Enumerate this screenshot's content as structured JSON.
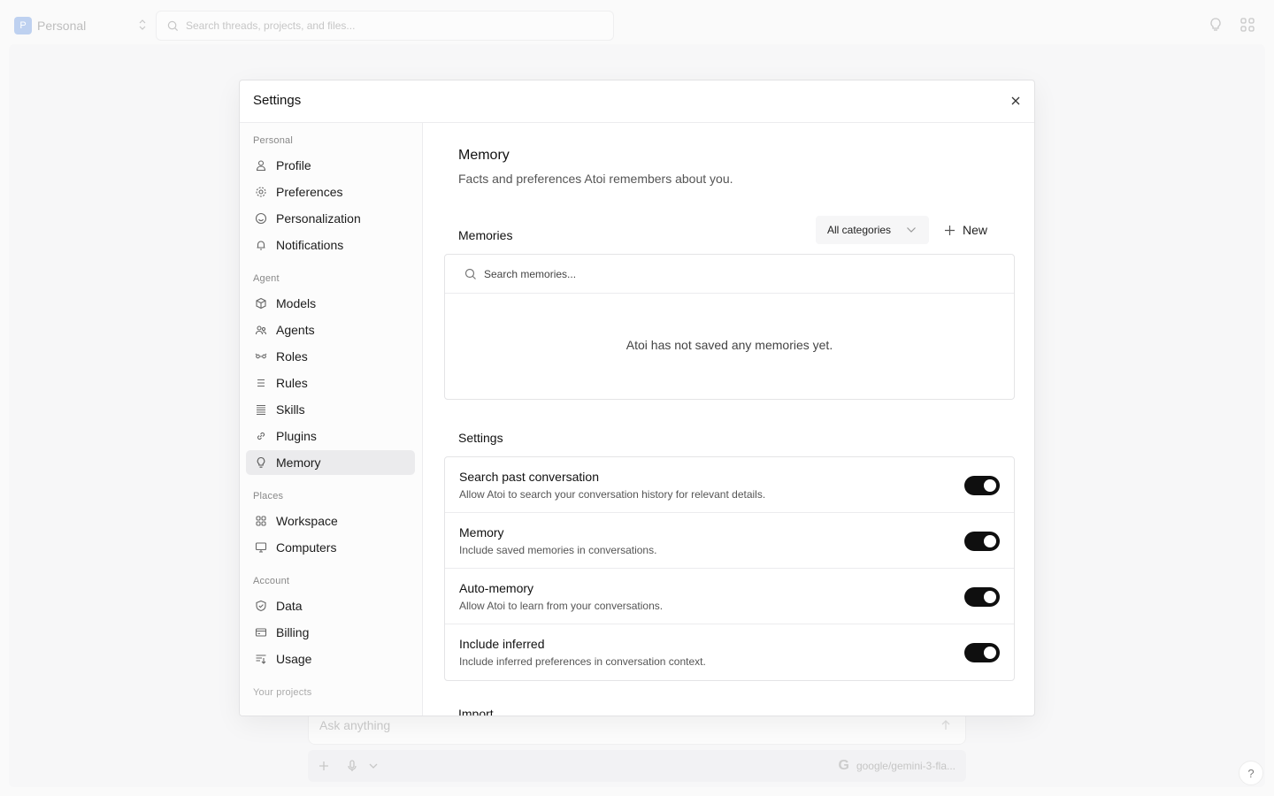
{
  "topbar": {
    "workspace_initial": "P",
    "workspace_name": "Personal",
    "search_placeholder": "Search threads, projects, and files...",
    "icons": [
      "lightbulb-icon",
      "apps-grid-icon"
    ]
  },
  "composer": {
    "placeholder": "Ask anything",
    "model": "google/gemini-3-fla...",
    "help_label": "?"
  },
  "modal": {
    "title": "Settings",
    "sidebar": {
      "groups": [
        {
          "label": "Personal",
          "items": [
            {
              "label": "Profile",
              "icon": "user-icon"
            },
            {
              "label": "Preferences",
              "icon": "gear-icon"
            },
            {
              "label": "Personalization",
              "icon": "smile-icon"
            },
            {
              "label": "Notifications",
              "icon": "bell-icon"
            }
          ]
        },
        {
          "label": "Agent",
          "items": [
            {
              "label": "Models",
              "icon": "cube-icon"
            },
            {
              "label": "Agents",
              "icon": "agents-icon"
            },
            {
              "label": "Roles",
              "icon": "roles-icon"
            },
            {
              "label": "Rules",
              "icon": "list-icon"
            },
            {
              "label": "Skills",
              "icon": "stack-icon"
            },
            {
              "label": "Plugins",
              "icon": "link-icon"
            },
            {
              "label": "Memory",
              "icon": "lightbulb-icon",
              "active": true
            }
          ]
        },
        {
          "label": "Places",
          "items": [
            {
              "label": "Workspace",
              "icon": "grid-icon"
            },
            {
              "label": "Computers",
              "icon": "monitor-icon"
            }
          ]
        },
        {
          "label": "Account",
          "items": [
            {
              "label": "Data",
              "icon": "shield-icon"
            },
            {
              "label": "Billing",
              "icon": "card-icon"
            },
            {
              "label": "Usage",
              "icon": "usage-icon"
            }
          ]
        },
        {
          "label": "Your projects",
          "items": []
        }
      ]
    },
    "content": {
      "title": "Memory",
      "subtitle": "Facts and preferences Atoi remembers about you.",
      "memories": {
        "heading": "Memories",
        "category_select": "All categories",
        "new_label": "New",
        "search_placeholder": "Search memories...",
        "empty_text": "Atoi has not saved any memories yet."
      },
      "settings": {
        "heading": "Settings",
        "rows": [
          {
            "name": "Search past conversation",
            "desc": "Allow Atoi to search your conversation history for relevant details.",
            "on": true
          },
          {
            "name": "Memory",
            "desc": "Include saved memories in conversations.",
            "on": true
          },
          {
            "name": "Auto-memory",
            "desc": "Allow Atoi to learn from your conversations.",
            "on": true
          },
          {
            "name": "Include inferred",
            "desc": "Include inferred preferences in conversation context.",
            "on": true
          }
        ]
      },
      "next_section": "Import"
    }
  }
}
